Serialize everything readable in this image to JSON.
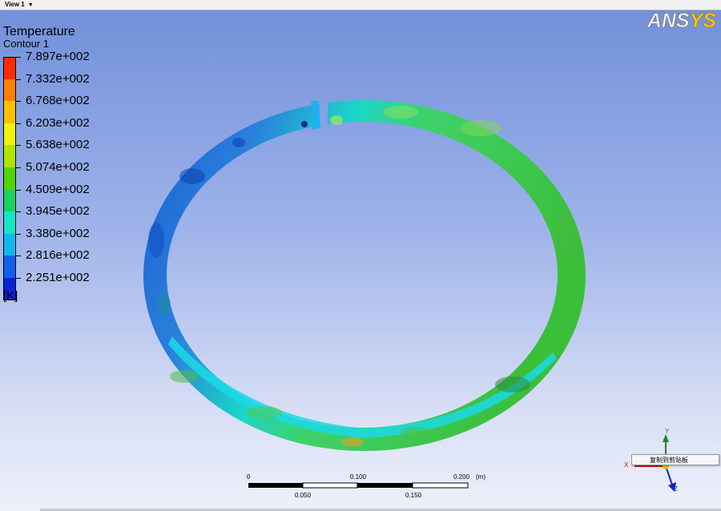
{
  "view_tab": {
    "label": "View 1",
    "chevron": "▼"
  },
  "brand": {
    "logo_main": "ANS",
    "logo_ys": "YS"
  },
  "legend": {
    "title": "Temperature",
    "subtitle": "Contour 1",
    "unit": "[K]",
    "values": [
      "7.897e+002",
      "7.332e+002",
      "6.768e+002",
      "6.203e+002",
      "5.638e+002",
      "5.074e+002",
      "4.509e+002",
      "3.945e+002",
      "3.380e+002",
      "2.816e+002",
      "2.251e+002"
    ],
    "colors": [
      "#ff2a00",
      "#ff8000",
      "#ffc000",
      "#f2f20a",
      "#aee600",
      "#52d400",
      "#19d35e",
      "#14e6c4",
      "#12b6f0",
      "#1160ee",
      "#0b22dd"
    ]
  },
  "scale_bar": {
    "top_labels": [
      "0",
      "0.100",
      "0.200"
    ],
    "unit": "(m)",
    "bottom_labels": [
      "0.050",
      "0.150"
    ]
  },
  "triad": {
    "y": "Y",
    "x": "X",
    "z": "Z"
  },
  "context_menu": {
    "item": "复制到剪贴板"
  }
}
